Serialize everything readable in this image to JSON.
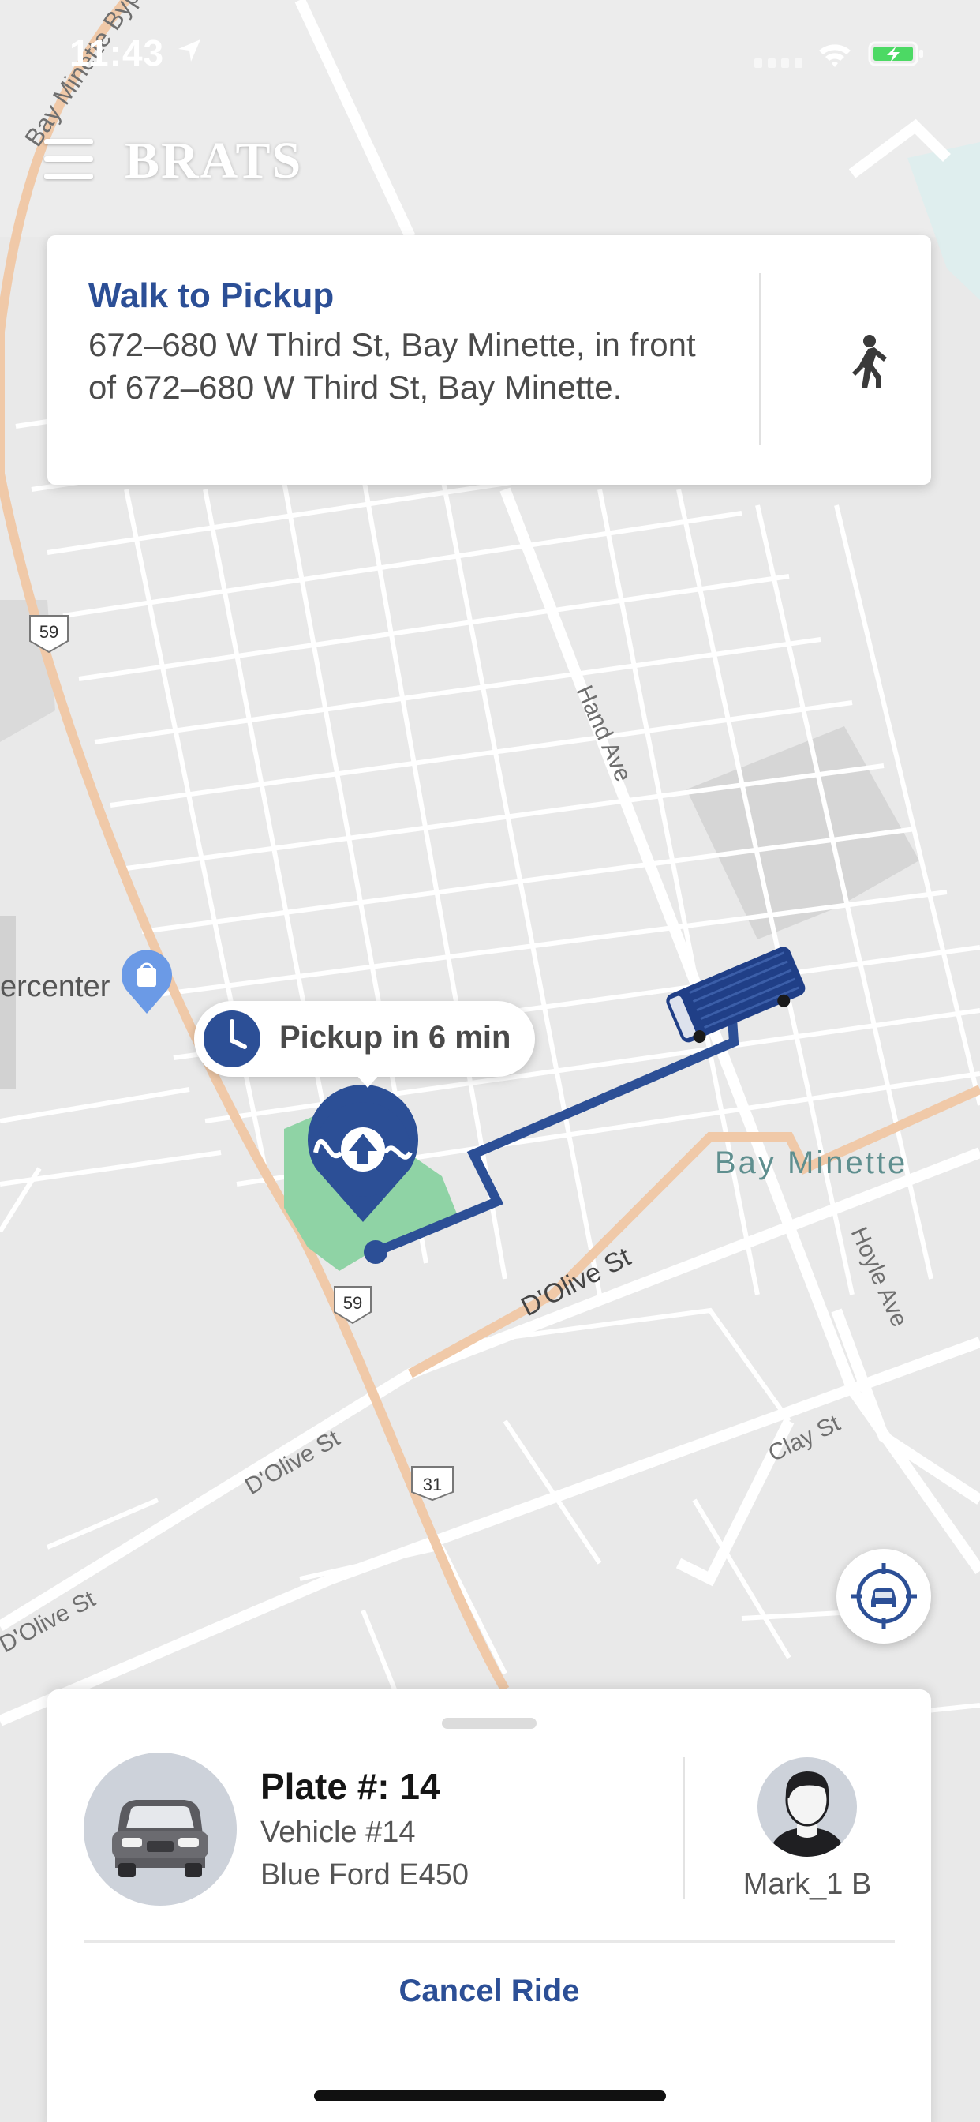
{
  "status_bar": {
    "time": "11:43"
  },
  "header": {
    "brand": "BRATS",
    "menu_icon": "hamburger-menu-icon"
  },
  "pickup_card": {
    "title": "Walk to Pickup",
    "address": "672–680 W Third St, Bay Minette, in front of 672–680 W Third St, Bay Minette.",
    "action_icon": "walking-person-icon"
  },
  "map": {
    "labels": {
      "bay_minette_bypass": "Bay Minette Bypass",
      "hand_ave": "Hand Ave",
      "hoyle_ave": "Hoyle Ave",
      "dolive_st_main": "D'Olive St",
      "dolive_st_west": "D'Olive St",
      "dolive_st_southwest": "D'Olive St",
      "clay_st": "Clay St",
      "town": "Bay Minette",
      "poi": "ercenter",
      "route_59_north": "59",
      "route_59_south": "59",
      "route_31": "31"
    },
    "eta_text": "Pickup in 6 min",
    "colors": {
      "route": "#2c4f96",
      "pickup_zone": "#8fd3a5",
      "major_road": "#f0c9a8",
      "town_label": "#5f8f8f"
    }
  },
  "ride_panel": {
    "plate": "Plate #: 14",
    "vehicle_number": "Vehicle #14",
    "vehicle_model": "Blue Ford E450",
    "driver_name": "Mark_1 B",
    "cancel_label": "Cancel Ride"
  },
  "colors": {
    "accent": "#2c4f96",
    "card_bg": "#ffffff",
    "map_bg": "#e9e9e9"
  }
}
